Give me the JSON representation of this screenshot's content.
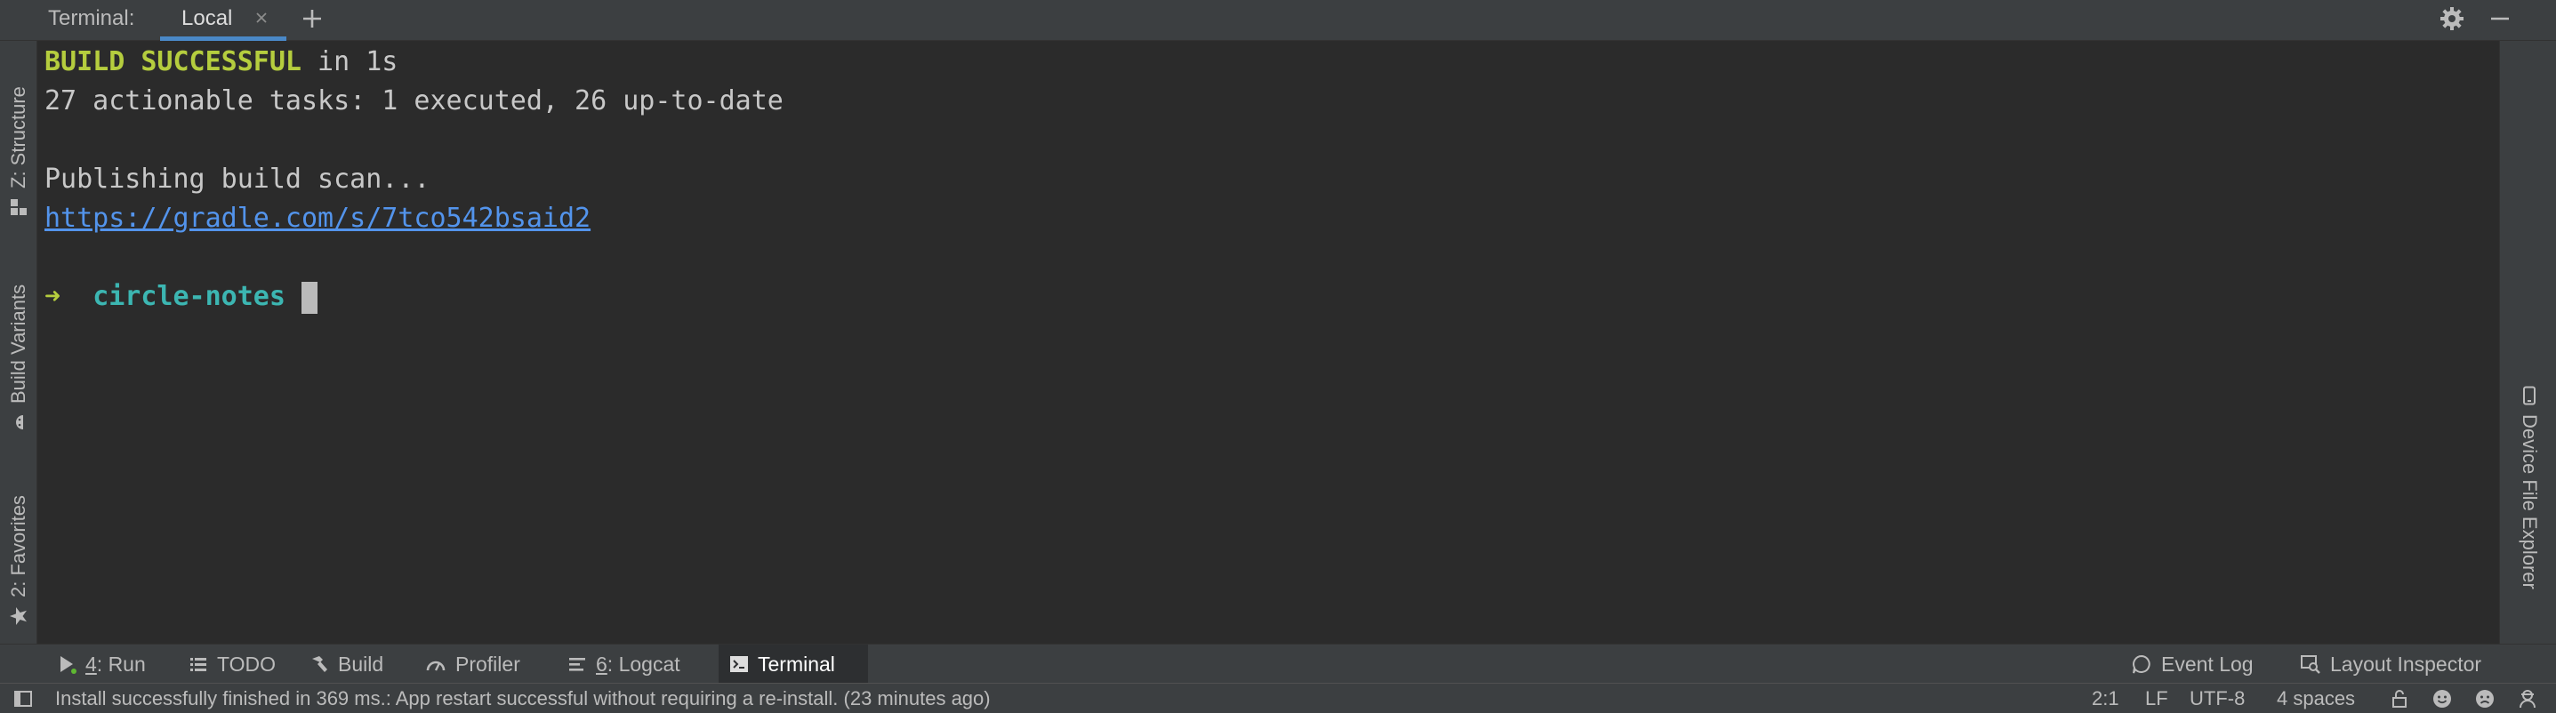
{
  "header": {
    "title": "Terminal:",
    "active_tab": "Local"
  },
  "left_sidebar": {
    "structure": "Z: Structure",
    "build_variants": "Build Variants",
    "favorites": "2: Favorites"
  },
  "right_sidebar": {
    "device_file_explorer": "Device File Explorer"
  },
  "terminal": {
    "build_status": "BUILD SUCCESSFUL",
    "build_time": " in 1s",
    "tasks_line": "27 actionable tasks: 1 executed, 26 up-to-date",
    "publishing_line": "Publishing build scan...",
    "scan_url": "https://gradle.com/s/7tco542bsaid2",
    "prompt_arrow": "➜",
    "cwd": "circle-notes"
  },
  "tool_tabs": {
    "run_num": "4",
    "run_label": ": Run",
    "todo": "TODO",
    "build": "Build",
    "profiler": "Profiler",
    "logcat_num": "6",
    "logcat_label": ": Logcat",
    "terminal": "Terminal",
    "event_log": "Event Log",
    "layout_inspector": "Layout Inspector"
  },
  "status_bar": {
    "message": "Install successfully finished in 369 ms.: App restart successful without requiring a re-install. (23 minutes ago)",
    "position": "2:1",
    "line_separator": "LF",
    "encoding": "UTF-8",
    "indent": "4 spaces"
  },
  "colors": {
    "build_success": "#b5cd3e",
    "link": "#5394ec",
    "cwd": "#3cb6b2",
    "tab_underline": "#4a88c7"
  },
  "icons": [
    "close-icon",
    "add-icon",
    "gear-icon",
    "minimize-icon",
    "structure-icon",
    "android-icon",
    "star-icon",
    "device-icon",
    "run-icon",
    "list-icon",
    "hammer-icon",
    "profiler-icon",
    "logcat-icon",
    "terminal-icon",
    "event-log-icon",
    "layout-inspector-icon",
    "panel-toggle-icon",
    "lock-icon",
    "smiley-icon",
    "sad-face-icon",
    "inspector-person-icon"
  ]
}
